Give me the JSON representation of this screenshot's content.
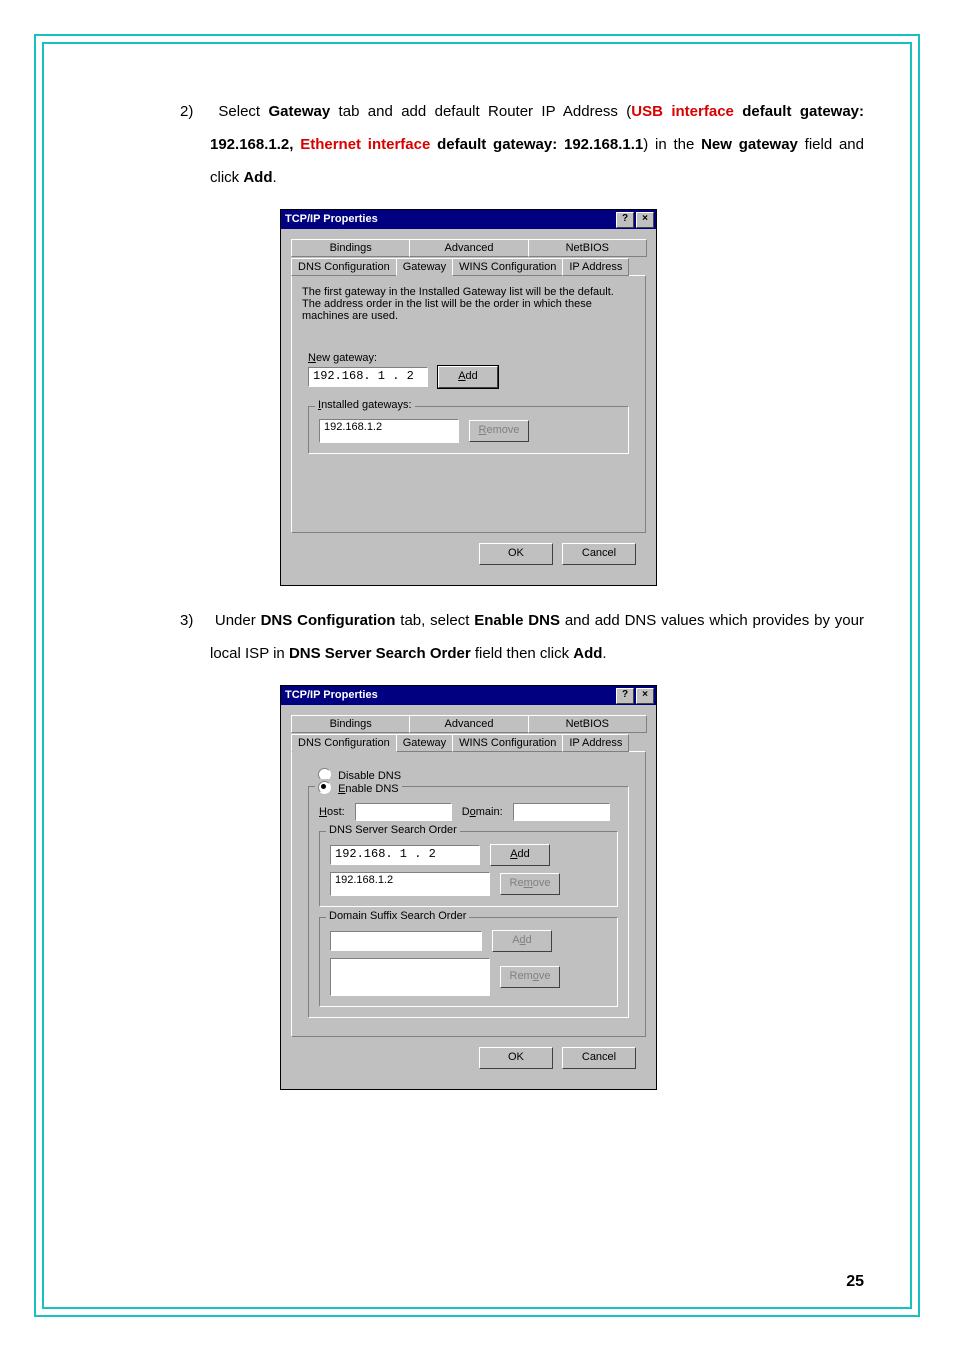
{
  "page_number": "25",
  "instr2": {
    "num": "2)",
    "p1a": "Select ",
    "gateway_b": "Gateway",
    "p1b": " tab and add default Router IP Address (",
    "usb_red": "USB interface",
    "p1c": " default gateway: 192.168.1.2, ",
    "eth_red": "Ethernet interface",
    "p1d": " default gateway: 192.168.1.1",
    "p1e": ") in the ",
    "newgw_b": "New gateway",
    "p1f": " field and click ",
    "add_b": "Add",
    "p1g": "."
  },
  "instr3": {
    "num": "3)",
    "p1a": "Under ",
    "dnsconf_b": "DNS Configuration",
    "p1b": " tab, select ",
    "enable_b": "Enable DNS",
    "p1c": " and add DNS values which provides by your local ISP in ",
    "order_b": "DNS Server Search Order",
    "p1d": " field then click ",
    "add_b": "Add",
    "p1e": "."
  },
  "dlg1": {
    "title": "TCP/IP Properties",
    "tabs_row1": [
      "Bindings",
      "Advanced",
      "NetBIOS"
    ],
    "tabs_row2": [
      "DNS Configuration",
      "Gateway",
      "WINS Configuration",
      "IP Address"
    ],
    "help": "The first gateway in the Installed Gateway list will be the default. The address order in the list will be the order in which these machines are used.",
    "newgw_label": "New gateway:",
    "newgw_value": "192.168. 1 . 2",
    "add_btn": "Add",
    "installed_legend": "Installed gateways:",
    "installed_item": "192.168.1.2",
    "remove_btn": "Remove",
    "ok": "OK",
    "cancel": "Cancel"
  },
  "dlg2": {
    "title": "TCP/IP Properties",
    "tabs_row1": [
      "Bindings",
      "Advanced",
      "NetBIOS"
    ],
    "tabs_row2": [
      "DNS Configuration",
      "Gateway",
      "WINS Configuration",
      "IP Address"
    ],
    "disable_label": "Disable DNS",
    "enable_label": "Enable DNS",
    "host_label": "Host:",
    "domain_label": "Domain:",
    "search_legend": "DNS Server Search Order",
    "search_value": "192.168. 1 . 2",
    "search_item": "192.168.1.2",
    "add_btn": "Add",
    "remove_btn": "Remove",
    "suffix_legend": "Domain Suffix Search Order",
    "suffix_add": "Add",
    "suffix_remove": "Remove",
    "ok": "OK",
    "cancel": "Cancel"
  }
}
